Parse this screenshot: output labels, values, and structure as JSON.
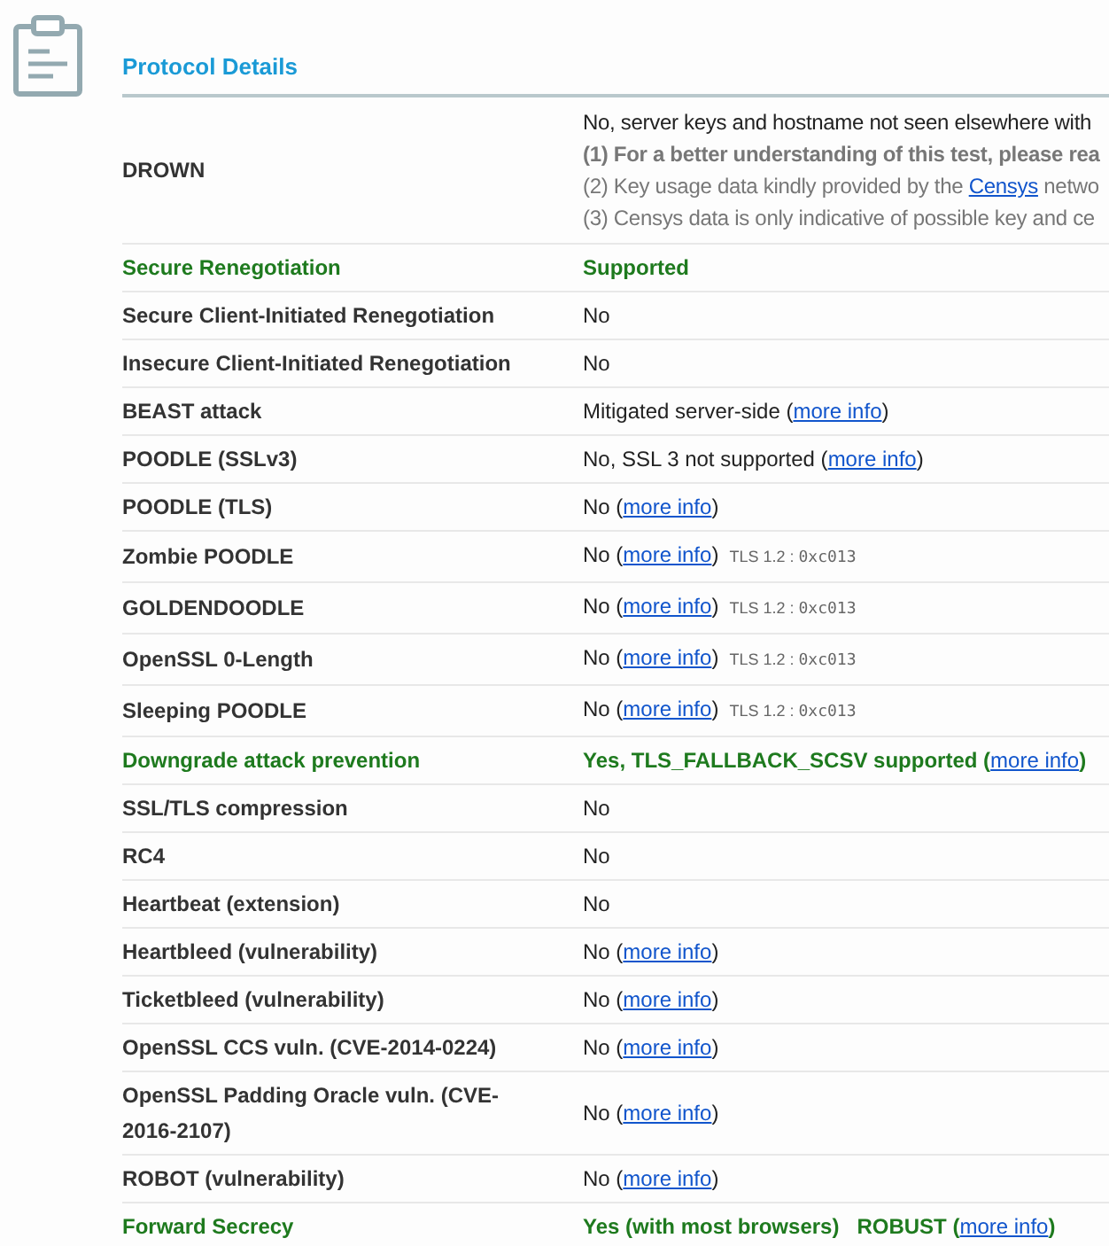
{
  "section": {
    "title": "Protocol Details"
  },
  "rows": [
    {
      "label": "DROWN",
      "good": false,
      "lines": [
        {
          "kind": "plain",
          "before": "No, server keys and hostname not seen elsewhere with"
        },
        {
          "kind": "bold",
          "before": "**(1)** For a better understanding of this test, please rea"
        },
        {
          "kind": "muted",
          "before": "(2) Key usage data kindly provided by the ",
          "link": "Censys",
          "after": " netwo"
        },
        {
          "kind": "muted",
          "before": "(3) Censys data is only indicative of possible key and ce"
        }
      ]
    },
    {
      "label": "Secure Renegotiation",
      "good": true,
      "lines": [
        {
          "kind": "plain",
          "before": "Supported"
        }
      ]
    },
    {
      "label": "Secure Client-Initiated Renegotiation",
      "good": false,
      "lines": [
        {
          "kind": "plain",
          "before": "No"
        }
      ]
    },
    {
      "label": "Insecure Client-Initiated Renegotiation",
      "good": false,
      "lines": [
        {
          "kind": "plain",
          "before": "No"
        }
      ]
    },
    {
      "label": "BEAST attack",
      "good": false,
      "lines": [
        {
          "kind": "plain",
          "before": "Mitigated server-side (",
          "link": "more info",
          "after": ")"
        }
      ]
    },
    {
      "label": "POODLE (SSLv3)",
      "good": false,
      "lines": [
        {
          "kind": "plain",
          "before": "No, SSL 3 not supported (",
          "link": "more info",
          "after": ")"
        }
      ]
    },
    {
      "label": "POODLE (TLS)",
      "good": false,
      "lines": [
        {
          "kind": "plain",
          "before": "No (",
          "link": "more info",
          "after": ")"
        }
      ]
    },
    {
      "label": "Zombie POODLE",
      "good": false,
      "lines": [
        {
          "kind": "plain",
          "before": "No (",
          "link": "more info",
          "after": ")",
          "note": "TLS 1.2 :",
          "code": "0xc013"
        }
      ]
    },
    {
      "label": "GOLDENDOODLE",
      "good": false,
      "lines": [
        {
          "kind": "plain",
          "before": "No (",
          "link": "more info",
          "after": ")",
          "note": "TLS 1.2 :",
          "code": "0xc013"
        }
      ]
    },
    {
      "label": "OpenSSL 0-Length",
      "good": false,
      "lines": [
        {
          "kind": "plain",
          "before": "No (",
          "link": "more info",
          "after": ")",
          "note": "TLS 1.2 :",
          "code": "0xc013"
        }
      ]
    },
    {
      "label": "Sleeping POODLE",
      "good": false,
      "lines": [
        {
          "kind": "plain",
          "before": "No (",
          "link": "more info",
          "after": ")",
          "note": "TLS 1.2 :",
          "code": "0xc013"
        }
      ]
    },
    {
      "label": "Downgrade attack prevention",
      "good": true,
      "lines": [
        {
          "kind": "plain",
          "before": "Yes, TLS_FALLBACK_SCSV supported (",
          "link": "more info",
          "after": ")"
        }
      ]
    },
    {
      "label": "SSL/TLS compression",
      "good": false,
      "lines": [
        {
          "kind": "plain",
          "before": "No"
        }
      ]
    },
    {
      "label": "RC4",
      "good": false,
      "lines": [
        {
          "kind": "plain",
          "before": "No"
        }
      ]
    },
    {
      "label": "Heartbeat (extension)",
      "good": false,
      "lines": [
        {
          "kind": "plain",
          "before": "No"
        }
      ]
    },
    {
      "label": "Heartbleed (vulnerability)",
      "good": false,
      "lines": [
        {
          "kind": "plain",
          "before": "No (",
          "link": "more info",
          "after": ")"
        }
      ]
    },
    {
      "label": "Ticketbleed (vulnerability)",
      "good": false,
      "lines": [
        {
          "kind": "plain",
          "before": "No (",
          "link": "more info",
          "after": ")"
        }
      ]
    },
    {
      "label": "OpenSSL CCS vuln. (CVE-2014-0224)",
      "good": false,
      "lines": [
        {
          "kind": "plain",
          "before": "No (",
          "link": "more info",
          "after": ")"
        }
      ]
    },
    {
      "label": "OpenSSL Padding Oracle vuln. (CVE-2016-2107)",
      "good": false,
      "lines": [
        {
          "kind": "plain",
          "before": "No (",
          "link": "more info",
          "after": ")"
        }
      ]
    },
    {
      "label": "ROBOT (vulnerability)",
      "good": false,
      "lines": [
        {
          "kind": "plain",
          "before": "No (",
          "link": "more info",
          "after": ")"
        }
      ]
    },
    {
      "label": "Forward Secrecy",
      "good": true,
      "lines": [
        {
          "kind": "plain",
          "before": "Yes (with most browsers)   ROBUST (",
          "link": "more info",
          "after": ")"
        }
      ]
    }
  ]
}
